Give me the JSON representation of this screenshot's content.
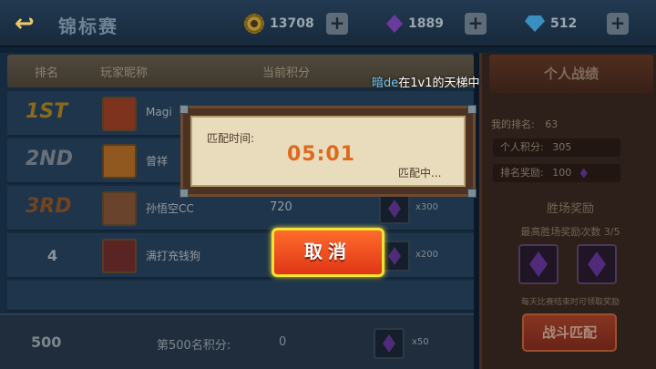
{
  "topbar": {
    "title": "锦标赛",
    "coins": "13708",
    "gems_purple": "1889",
    "diamonds": "512",
    "plus": "+"
  },
  "ranking": {
    "headers": [
      "排名",
      "玩家昵称",
      "当前积分"
    ],
    "rows": [
      {
        "rank": "1ST",
        "name": "Magi",
        "score": "",
        "qty": ""
      },
      {
        "rank": "2ND",
        "name": "曾祥",
        "score": "",
        "qty": ""
      },
      {
        "rank": "3RD",
        "name": "孙悟空CC",
        "score": "720",
        "qty": "x300"
      },
      {
        "rank": "4",
        "name": "满打充钱狗",
        "score": "",
        "qty": "x200"
      }
    ],
    "bottom": {
      "my_rank": "500",
      "label": "第500名积分:",
      "score": "0",
      "qty": "x50"
    }
  },
  "personal": {
    "title": "个人战绩",
    "my_rank_label": "我的排名:",
    "my_rank_value": "63",
    "score_label": "个人积分:",
    "score_value": "305",
    "reward_label": "排名奖励:",
    "reward_value": "100",
    "win_reward_title": "胜场奖励",
    "win_progress": "最高胜场奖励次数 3/5",
    "note": "每天比赛结束时可领取奖励",
    "fight_button": "战斗匹配"
  },
  "broadcast": {
    "who": "暗de",
    "text": "在1v1的天梯中"
  },
  "dialog": {
    "label": "匹配时间:",
    "timer": "05:01",
    "status": "匹配中..."
  },
  "cancel_button": "取消"
}
